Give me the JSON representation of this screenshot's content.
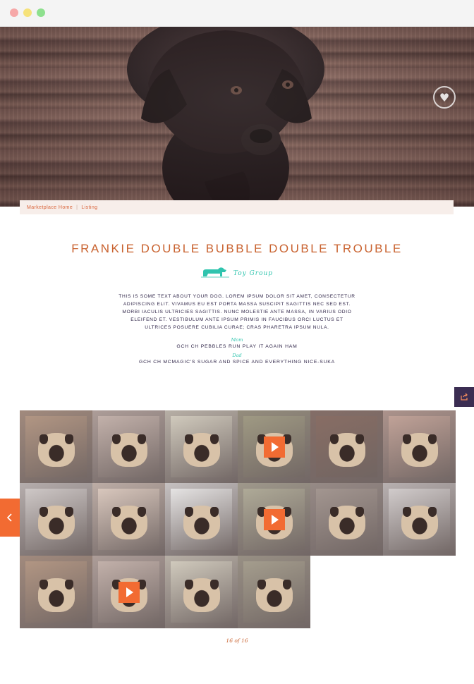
{
  "window": {
    "controls": [
      "close",
      "minimize",
      "maximize"
    ]
  },
  "hero": {
    "favorite_icon": "heart-icon"
  },
  "breadcrumb": {
    "items": [
      "Marketplace Home",
      "Listing"
    ],
    "separator": "|"
  },
  "listing": {
    "title": "FRANKIE DOUBLE BUBBLE DOUBLE TROUBLE",
    "group_label": "Toy Group",
    "group_icon": "dog-silhouette-icon",
    "description": "THIS IS SOME TEXT ABOUT YOUR DOG. LOREM IPSUM DOLOR SIT AMET, CONSECTETUR ADIPISCING ELIT. VIVAMUS EU EST PORTA MASSA SUSCIPIT SAGITTIS NEC SED EST. MORBI IACULIS ULTRICIES SAGITTIS. NUNC MOLESTIE ANTE MASSA, IN VARIUS ODIO ELEIFEND ET. VESTIBULUM ANTE IPSUM PRIMIS IN FAUCIBUS ORCI LUCTUS ET ULTRICES POSUERE CUBILIA CURAE; CRAS PHARETRA IPSUM NULA.",
    "mom_label": "Mom",
    "mom_name": "GCH CH PEBBLES RUN PLAY IT AGAIN HAM",
    "dad_label": "Dad",
    "dad_name": "GCH CH MCMAGIC'S SUGAR AND SPICE AND EVERYTHING NICE-SUKA"
  },
  "side_controls": {
    "share_icon": "share-icon",
    "prev_icon": "chevron-left-icon"
  },
  "gallery": {
    "tiles": [
      {
        "kind": "photo",
        "tone": "#b79a86"
      },
      {
        "kind": "photo",
        "tone": "#c9b7b0"
      },
      {
        "kind": "photo",
        "tone": "#d8d2c4"
      },
      {
        "kind": "video",
        "tone": "#a39e86"
      },
      {
        "kind": "photo",
        "tone": "#8a6e64"
      },
      {
        "kind": "photo",
        "tone": "#c7a79c"
      },
      {
        "kind": "photo",
        "tone": "#d6d0cf"
      },
      {
        "kind": "photo",
        "tone": "#e1cfc4"
      },
      {
        "kind": "photo",
        "tone": "#efeeee"
      },
      {
        "kind": "video",
        "tone": "#b4b09c"
      },
      {
        "kind": "photo",
        "tone": "#a79a94"
      },
      {
        "kind": "photo",
        "tone": "#d9d4d4"
      },
      {
        "kind": "photo",
        "tone": "#b79a86"
      },
      {
        "kind": "video",
        "tone": "#c9b7b0"
      },
      {
        "kind": "photo",
        "tone": "#d8d2c4"
      },
      {
        "kind": "photo",
        "tone": "#a9a291"
      }
    ],
    "counter": "16 of 16"
  },
  "colors": {
    "accent": "#f26b32",
    "title": "#c9622f",
    "teal": "#2fc4ae",
    "navy": "#2f2548"
  }
}
